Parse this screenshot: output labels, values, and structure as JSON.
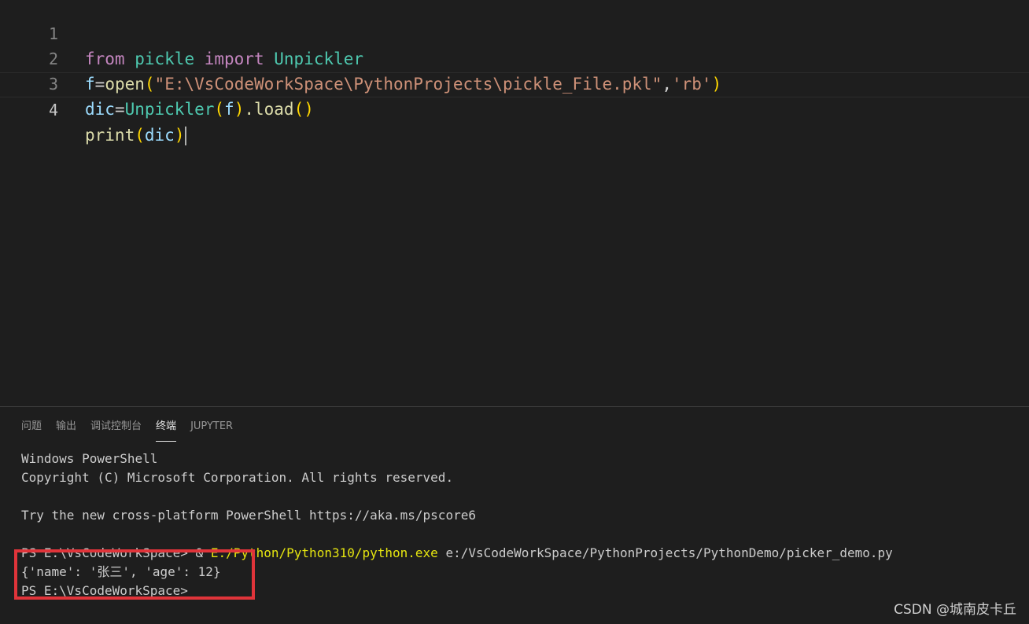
{
  "editor": {
    "lines": [
      {
        "num": "1",
        "tokens": [
          "from",
          "pickle",
          "import",
          "Unpickler"
        ]
      },
      {
        "num": "2",
        "tokens": [
          "f",
          "=",
          "open",
          "(",
          "\"E:\\VsCodeWorkSpace\\PythonProjects\\pickle_File.pkl\"",
          ",",
          "'rb'",
          ")"
        ]
      },
      {
        "num": "3",
        "tokens": [
          "dic",
          "=",
          "Unpickler",
          "(",
          "f",
          ")",
          ".load",
          "(",
          ")"
        ]
      },
      {
        "num": "4",
        "tokens": [
          "print",
          "(",
          "dic",
          ")"
        ]
      }
    ],
    "current_line": "4"
  },
  "panel": {
    "tabs": [
      "问题",
      "输出",
      "调试控制台",
      "终端",
      "JUPYTER"
    ],
    "active_tab": "终端",
    "terminal_lines": {
      "l1": "Windows PowerShell",
      "l2": "Copyright (C) Microsoft Corporation. All rights reserved.",
      "l3": "",
      "l4": "Try the new cross-platform PowerShell https://aka.ms/pscore6",
      "l5": "",
      "l6a": "PS E:\\VsCodeWorkSpace> & ",
      "l6b": "E:/Python/Python310/python.exe",
      "l6c": " e:/VsCodeWorkSpace/PythonProjects/PythonDemo/picker_demo.py",
      "l7": "{'name': '张三', 'age': 12}",
      "l8": "PS E:\\VsCodeWorkSpace>"
    }
  },
  "colors": {
    "keyword": "#c586c0",
    "module": "#4ec9b0",
    "variable": "#9cdcfe",
    "function": "#dcdcaa",
    "string": "#ce9178",
    "bracket1": "#ffd700",
    "bracket2": "#da70d6",
    "highlight_box": "#e0343a"
  },
  "watermark": "CSDN @城南皮卡丘"
}
